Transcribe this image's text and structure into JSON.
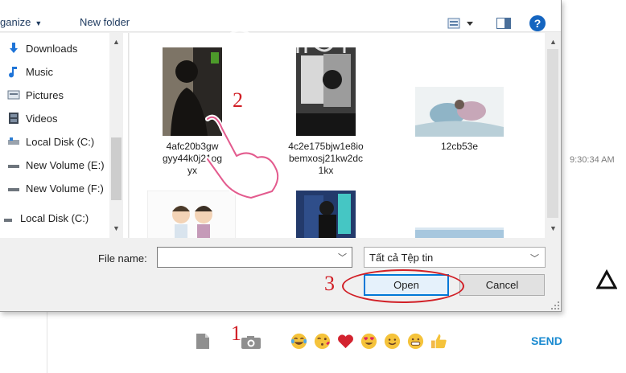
{
  "dialog": {
    "toolbar": {
      "organize": "ganize",
      "new_folder": "New folder"
    },
    "nav": {
      "items": [
        {
          "label": "Downloads",
          "icon": "download-arrow-icon"
        },
        {
          "label": "Music",
          "icon": "music-note-icon"
        },
        {
          "label": "Pictures",
          "icon": "pictures-icon"
        },
        {
          "label": "Videos",
          "icon": "videos-icon"
        },
        {
          "label": "Local Disk (C:)",
          "icon": "drive-icon"
        },
        {
          "label": "New Volume (E:)",
          "icon": "drive-icon"
        },
        {
          "label": "New Volume (F:)",
          "icon": "drive-icon"
        },
        {
          "label": "Local Disk (C:)",
          "icon": "drive-icon"
        }
      ]
    },
    "files": [
      {
        "name": "4afc20b3gw\ngyy44k0j21og\nyx"
      },
      {
        "name": "4c2e175bjw1e8io\nbemxosj21kw2dc\n1kx"
      },
      {
        "name": "12cb53e"
      }
    ],
    "file_name_label": "File name:",
    "file_name_value": "",
    "file_type": "Tất cả Tệp tin",
    "open_label": "Open",
    "cancel_label": "Cancel"
  },
  "chat": {
    "timestamp": "9:30:34 AM",
    "send_label": "SEND",
    "emojis": [
      "tears-of-joy-emoji",
      "blowing-kiss-emoji",
      "red-heart-emoji",
      "heart-eyes-emoji",
      "smiling-face-emoji",
      "grinning-face-emoji",
      "thumbs-up-emoji"
    ]
  },
  "annotations": {
    "step1": "1",
    "step2": "2",
    "step3": "3"
  },
  "colors": {
    "annotation_red": "#d11f26",
    "accent_blue": "#0078d7",
    "send_blue": "#1a8ad0"
  }
}
